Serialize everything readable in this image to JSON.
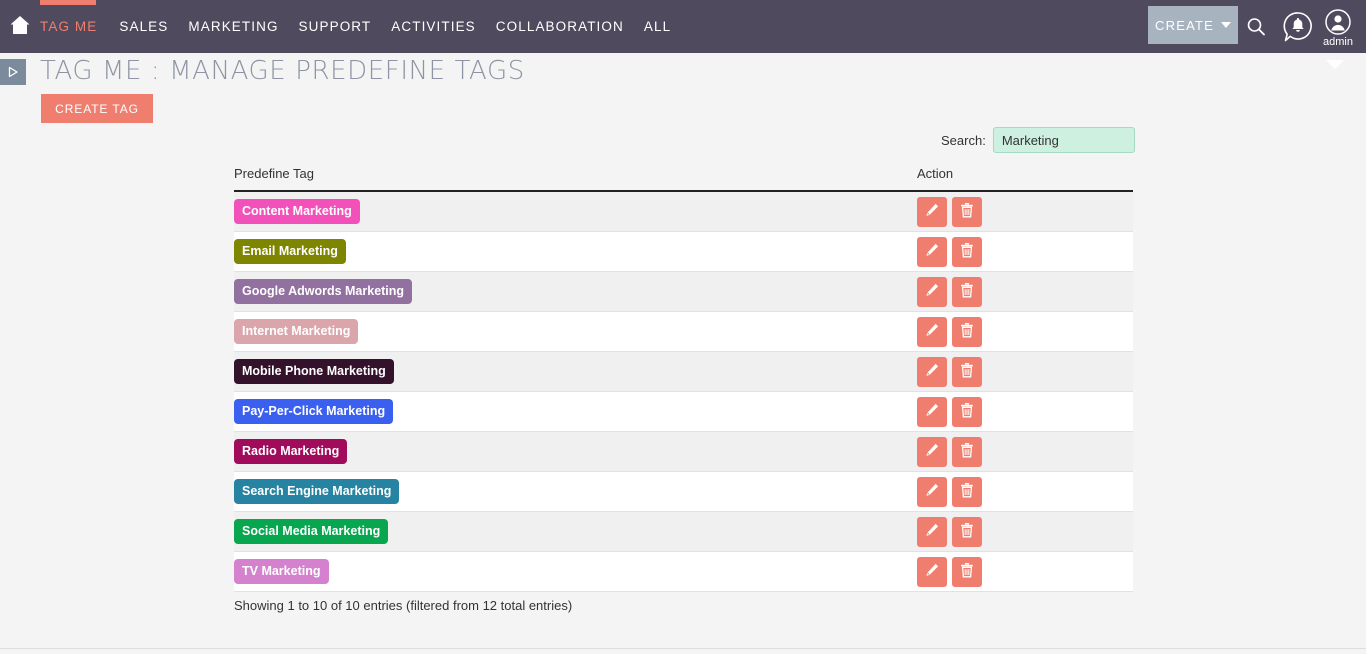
{
  "navbar": {
    "home_icon": "home-icon",
    "links": [
      {
        "label": "TAG ME",
        "active": true
      },
      {
        "label": "SALES",
        "active": false
      },
      {
        "label": "MARKETING",
        "active": false
      },
      {
        "label": "SUPPORT",
        "active": false
      },
      {
        "label": "ACTIVITIES",
        "active": false
      },
      {
        "label": "COLLABORATION",
        "active": false
      },
      {
        "label": "ALL",
        "active": false
      }
    ],
    "create_button": {
      "label": "CREATE",
      "icon": "chevron-down-icon"
    },
    "search_icon": "search-icon",
    "notification_icon": "bell-notification-icon",
    "user_icon": "user-avatar-icon",
    "user_name": "admin",
    "background_color": "#504a5e",
    "accent_color": "#ef7e6e",
    "create_button_color": "#a8b3c0"
  },
  "header": {
    "sidebar_toggle_icon": "expand-sidebar-icon",
    "title": "TAG ME : MANAGE PREDEFINE TAGS",
    "create_tag_label": "CREATE TAG",
    "dropdown_caret_icon": "chevron-down-icon"
  },
  "search": {
    "label": "Search:",
    "value": "Marketing",
    "placeholder": ""
  },
  "table": {
    "columns": [
      "Predefine Tag",
      "Action"
    ],
    "rows": [
      {
        "tag": "Content Marketing",
        "color": "#f251ba"
      },
      {
        "tag": "Email Marketing",
        "color": "#7e8600"
      },
      {
        "tag": "Google Adwords Marketing",
        "color": "#9270a0"
      },
      {
        "tag": "Internet Marketing",
        "color": "#dba6ab"
      },
      {
        "tag": "Mobile Phone Marketing",
        "color": "#34122c"
      },
      {
        "tag": "Pay-Per-Click Marketing",
        "color": "#3b60ef"
      },
      {
        "tag": "Radio Marketing",
        "color": "#a10b5b"
      },
      {
        "tag": "Search Engine Marketing",
        "color": "#2684a2"
      },
      {
        "tag": "Social Media Marketing",
        "color": "#09a650"
      },
      {
        "tag": "TV Marketing",
        "color": "#d482ce"
      }
    ],
    "edit_icon": "pencil-edit-icon",
    "delete_icon": "trash-delete-icon",
    "action_button_color": "#ef7e6e",
    "info": "Showing 1 to 10 of 10 entries (filtered from 12 total entries)"
  }
}
